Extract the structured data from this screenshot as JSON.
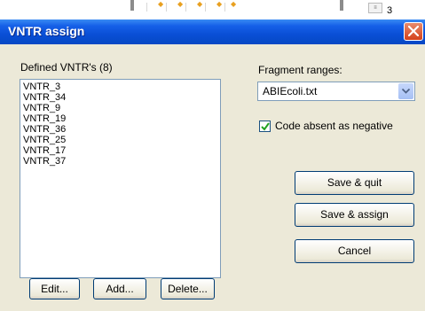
{
  "background_window": {
    "cell_number": "3"
  },
  "dialog": {
    "title": "VNTR assign",
    "defined_label": "Defined VNTR's (8)",
    "vntr_list": [
      "VNTR_3",
      "VNTR_34",
      "VNTR_9",
      "VNTR_19",
      "VNTR_36",
      "VNTR_25",
      "VNTR_17",
      "VNTR_37"
    ],
    "fragment_ranges_label": "Fragment ranges:",
    "fragment_file_selected": "ABIEcoli.txt",
    "code_absent_label": "Code absent as negative",
    "code_absent_checked": true,
    "buttons": {
      "save_quit": "Save & quit",
      "save_assign": "Save & assign",
      "cancel": "Cancel",
      "edit": "Edit...",
      "add": "Add...",
      "delete": "Delete..."
    }
  },
  "colors": {
    "titlebar": "#0a4fd6",
    "dialog_bg": "#ece9d8",
    "close_button": "#d4411b",
    "border": "#7f9db9"
  },
  "icons": {
    "close": "close-icon",
    "dropdown": "chevron-down-icon",
    "check": "checkmark-icon"
  }
}
